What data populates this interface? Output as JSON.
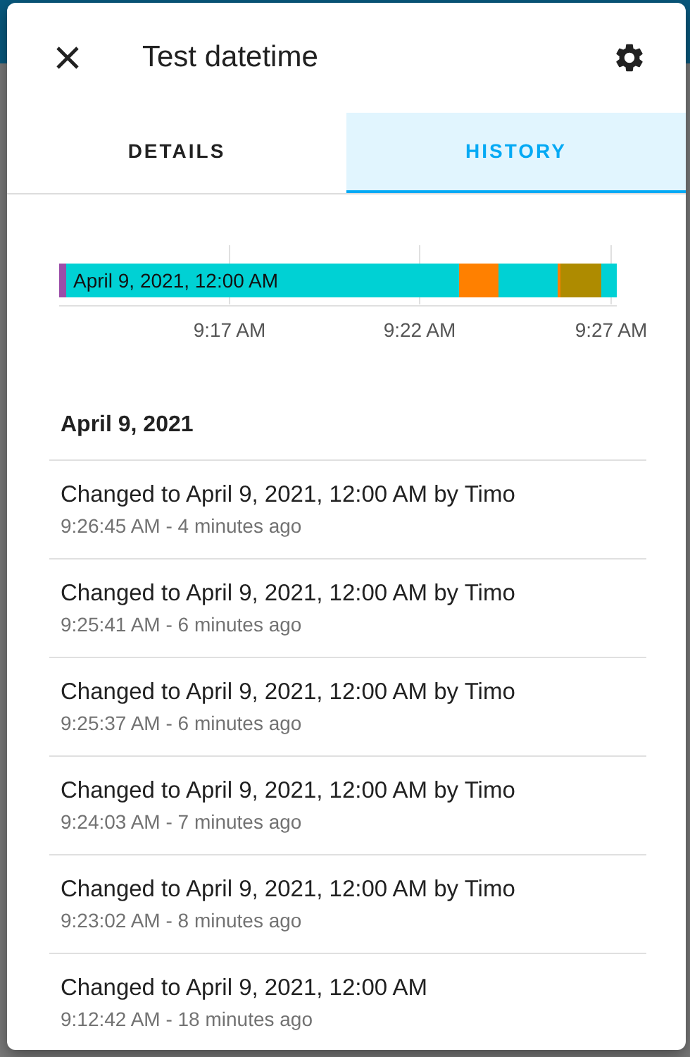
{
  "dialog": {
    "title": "Test datetime"
  },
  "tabs": [
    {
      "label": "DETAILS",
      "selected": false
    },
    {
      "label": "HISTORY",
      "selected": true
    }
  ],
  "timeline": {
    "label": "April 9, 2021, 12:00 AM",
    "segments": [
      {
        "color": "#9b4ea8"
      },
      {
        "color": "#00d1d4"
      },
      {
        "color": "#ff8000"
      },
      {
        "color": "#00d1d4"
      },
      {
        "color": "#ff8000"
      },
      {
        "color": "#ae8b00"
      },
      {
        "color": "#00d1d4"
      }
    ],
    "ticks": [
      "9:17 AM",
      "9:22 AM",
      "9:27 AM"
    ]
  },
  "date_heading": "April 9, 2021",
  "entries": [
    {
      "message": "Changed to April 9, 2021, 12:00 AM by Timo",
      "time": "9:26:45 AM - 4 minutes ago"
    },
    {
      "message": "Changed to April 9, 2021, 12:00 AM by Timo",
      "time": "9:25:41 AM - 6 minutes ago"
    },
    {
      "message": "Changed to April 9, 2021, 12:00 AM by Timo",
      "time": "9:25:37 AM - 6 minutes ago"
    },
    {
      "message": "Changed to April 9, 2021, 12:00 AM by Timo",
      "time": "9:24:03 AM - 7 minutes ago"
    },
    {
      "message": "Changed to April 9, 2021, 12:00 AM by Timo",
      "time": "9:23:02 AM - 8 minutes ago"
    },
    {
      "message": "Changed to April 9, 2021, 12:00 AM",
      "time": "9:12:42 AM - 18 minutes ago"
    }
  ]
}
